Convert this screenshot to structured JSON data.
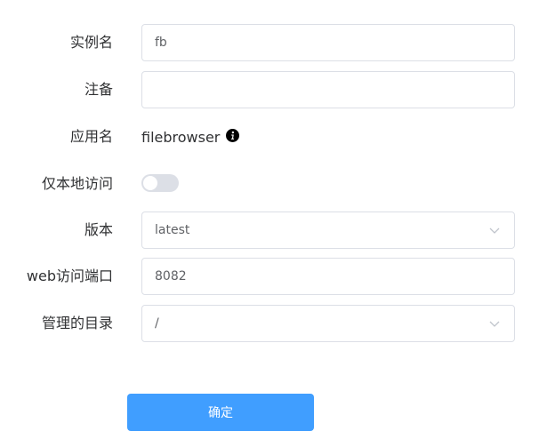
{
  "form": {
    "instance_name": {
      "label": "实例名",
      "value": "fb"
    },
    "remark": {
      "label": "注备",
      "value": ""
    },
    "app_name": {
      "label": "应用名",
      "value": "filebrowser",
      "info_icon": "info-circle-icon"
    },
    "local_only": {
      "label": "仅本地访问",
      "enabled": false
    },
    "version": {
      "label": "版本",
      "value": "latest"
    },
    "web_port": {
      "label": "web访问端口",
      "value": "8082"
    },
    "managed_dir": {
      "label": "管理的目录",
      "value": "/"
    },
    "submit_label": "确定"
  },
  "colors": {
    "primary": "#409eff",
    "border": "#dcdfe6",
    "switch_off": "#dcdfe6",
    "label_text": "#303133",
    "input_text": "#606266"
  }
}
